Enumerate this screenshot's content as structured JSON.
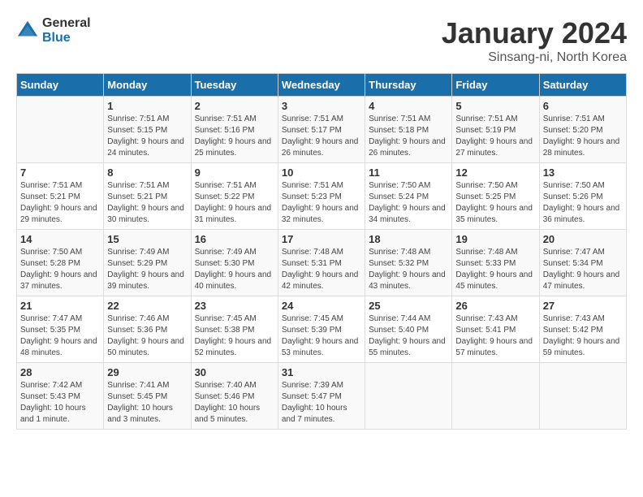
{
  "logo": {
    "general": "General",
    "blue": "Blue"
  },
  "title": "January 2024",
  "location": "Sinsang-ni, North Korea",
  "days_of_week": [
    "Sunday",
    "Monday",
    "Tuesday",
    "Wednesday",
    "Thursday",
    "Friday",
    "Saturday"
  ],
  "weeks": [
    [
      {
        "day": "",
        "sunrise": "",
        "sunset": "",
        "daylight": ""
      },
      {
        "day": "1",
        "sunrise": "Sunrise: 7:51 AM",
        "sunset": "Sunset: 5:15 PM",
        "daylight": "Daylight: 9 hours and 24 minutes."
      },
      {
        "day": "2",
        "sunrise": "Sunrise: 7:51 AM",
        "sunset": "Sunset: 5:16 PM",
        "daylight": "Daylight: 9 hours and 25 minutes."
      },
      {
        "day": "3",
        "sunrise": "Sunrise: 7:51 AM",
        "sunset": "Sunset: 5:17 PM",
        "daylight": "Daylight: 9 hours and 26 minutes."
      },
      {
        "day": "4",
        "sunrise": "Sunrise: 7:51 AM",
        "sunset": "Sunset: 5:18 PM",
        "daylight": "Daylight: 9 hours and 26 minutes."
      },
      {
        "day": "5",
        "sunrise": "Sunrise: 7:51 AM",
        "sunset": "Sunset: 5:19 PM",
        "daylight": "Daylight: 9 hours and 27 minutes."
      },
      {
        "day": "6",
        "sunrise": "Sunrise: 7:51 AM",
        "sunset": "Sunset: 5:20 PM",
        "daylight": "Daylight: 9 hours and 28 minutes."
      }
    ],
    [
      {
        "day": "7",
        "sunrise": "Sunrise: 7:51 AM",
        "sunset": "Sunset: 5:21 PM",
        "daylight": "Daylight: 9 hours and 29 minutes."
      },
      {
        "day": "8",
        "sunrise": "Sunrise: 7:51 AM",
        "sunset": "Sunset: 5:21 PM",
        "daylight": "Daylight: 9 hours and 30 minutes."
      },
      {
        "day": "9",
        "sunrise": "Sunrise: 7:51 AM",
        "sunset": "Sunset: 5:22 PM",
        "daylight": "Daylight: 9 hours and 31 minutes."
      },
      {
        "day": "10",
        "sunrise": "Sunrise: 7:51 AM",
        "sunset": "Sunset: 5:23 PM",
        "daylight": "Daylight: 9 hours and 32 minutes."
      },
      {
        "day": "11",
        "sunrise": "Sunrise: 7:50 AM",
        "sunset": "Sunset: 5:24 PM",
        "daylight": "Daylight: 9 hours and 34 minutes."
      },
      {
        "day": "12",
        "sunrise": "Sunrise: 7:50 AM",
        "sunset": "Sunset: 5:25 PM",
        "daylight": "Daylight: 9 hours and 35 minutes."
      },
      {
        "day": "13",
        "sunrise": "Sunrise: 7:50 AM",
        "sunset": "Sunset: 5:26 PM",
        "daylight": "Daylight: 9 hours and 36 minutes."
      }
    ],
    [
      {
        "day": "14",
        "sunrise": "Sunrise: 7:50 AM",
        "sunset": "Sunset: 5:28 PM",
        "daylight": "Daylight: 9 hours and 37 minutes."
      },
      {
        "day": "15",
        "sunrise": "Sunrise: 7:49 AM",
        "sunset": "Sunset: 5:29 PM",
        "daylight": "Daylight: 9 hours and 39 minutes."
      },
      {
        "day": "16",
        "sunrise": "Sunrise: 7:49 AM",
        "sunset": "Sunset: 5:30 PM",
        "daylight": "Daylight: 9 hours and 40 minutes."
      },
      {
        "day": "17",
        "sunrise": "Sunrise: 7:48 AM",
        "sunset": "Sunset: 5:31 PM",
        "daylight": "Daylight: 9 hours and 42 minutes."
      },
      {
        "day": "18",
        "sunrise": "Sunrise: 7:48 AM",
        "sunset": "Sunset: 5:32 PM",
        "daylight": "Daylight: 9 hours and 43 minutes."
      },
      {
        "day": "19",
        "sunrise": "Sunrise: 7:48 AM",
        "sunset": "Sunset: 5:33 PM",
        "daylight": "Daylight: 9 hours and 45 minutes."
      },
      {
        "day": "20",
        "sunrise": "Sunrise: 7:47 AM",
        "sunset": "Sunset: 5:34 PM",
        "daylight": "Daylight: 9 hours and 47 minutes."
      }
    ],
    [
      {
        "day": "21",
        "sunrise": "Sunrise: 7:47 AM",
        "sunset": "Sunset: 5:35 PM",
        "daylight": "Daylight: 9 hours and 48 minutes."
      },
      {
        "day": "22",
        "sunrise": "Sunrise: 7:46 AM",
        "sunset": "Sunset: 5:36 PM",
        "daylight": "Daylight: 9 hours and 50 minutes."
      },
      {
        "day": "23",
        "sunrise": "Sunrise: 7:45 AM",
        "sunset": "Sunset: 5:38 PM",
        "daylight": "Daylight: 9 hours and 52 minutes."
      },
      {
        "day": "24",
        "sunrise": "Sunrise: 7:45 AM",
        "sunset": "Sunset: 5:39 PM",
        "daylight": "Daylight: 9 hours and 53 minutes."
      },
      {
        "day": "25",
        "sunrise": "Sunrise: 7:44 AM",
        "sunset": "Sunset: 5:40 PM",
        "daylight": "Daylight: 9 hours and 55 minutes."
      },
      {
        "day": "26",
        "sunrise": "Sunrise: 7:43 AM",
        "sunset": "Sunset: 5:41 PM",
        "daylight": "Daylight: 9 hours and 57 minutes."
      },
      {
        "day": "27",
        "sunrise": "Sunrise: 7:43 AM",
        "sunset": "Sunset: 5:42 PM",
        "daylight": "Daylight: 9 hours and 59 minutes."
      }
    ],
    [
      {
        "day": "28",
        "sunrise": "Sunrise: 7:42 AM",
        "sunset": "Sunset: 5:43 PM",
        "daylight": "Daylight: 10 hours and 1 minute."
      },
      {
        "day": "29",
        "sunrise": "Sunrise: 7:41 AM",
        "sunset": "Sunset: 5:45 PM",
        "daylight": "Daylight: 10 hours and 3 minutes."
      },
      {
        "day": "30",
        "sunrise": "Sunrise: 7:40 AM",
        "sunset": "Sunset: 5:46 PM",
        "daylight": "Daylight: 10 hours and 5 minutes."
      },
      {
        "day": "31",
        "sunrise": "Sunrise: 7:39 AM",
        "sunset": "Sunset: 5:47 PM",
        "daylight": "Daylight: 10 hours and 7 minutes."
      },
      {
        "day": "",
        "sunrise": "",
        "sunset": "",
        "daylight": ""
      },
      {
        "day": "",
        "sunrise": "",
        "sunset": "",
        "daylight": ""
      },
      {
        "day": "",
        "sunrise": "",
        "sunset": "",
        "daylight": ""
      }
    ]
  ]
}
